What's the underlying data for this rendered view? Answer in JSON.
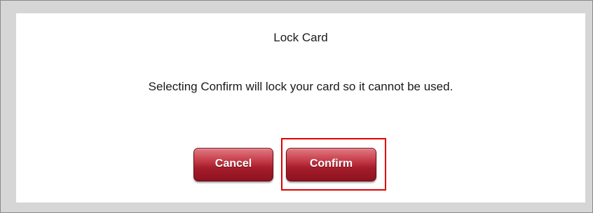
{
  "dialog": {
    "title": "Lock Card",
    "message": "Selecting Confirm will lock your card so it cannot be used.",
    "buttons": {
      "cancel_label": "Cancel",
      "confirm_label": "Confirm"
    }
  },
  "colors": {
    "button": "#a51d2b",
    "highlight": "#e00000",
    "frame": "#d6d6d6"
  }
}
